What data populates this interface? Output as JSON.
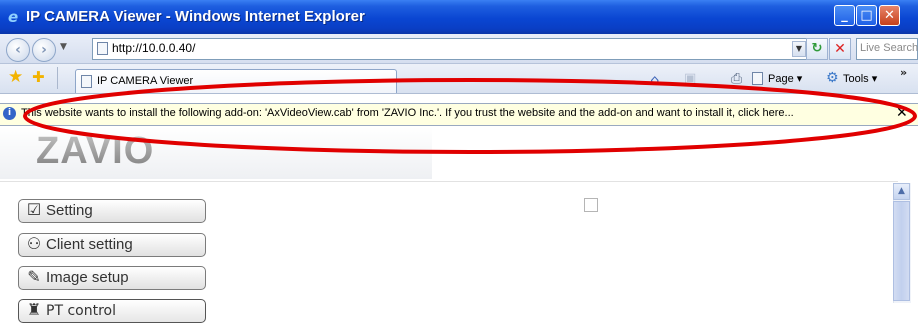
{
  "window": {
    "title": "IP CAMERA Viewer - Windows Internet Explorer",
    "controls": {
      "minimize": "_",
      "maximize": "□",
      "close": "✕"
    }
  },
  "address_bar": {
    "url": "http://10.0.0.40/",
    "search_placeholder": "Live Search"
  },
  "tabs": [
    {
      "label": "IP CAMERA Viewer"
    }
  ],
  "command_bar": {
    "page_label": "Page ▾",
    "tools_label": "Tools ▾"
  },
  "info_bar": {
    "message": "This website wants to install the following add-on: 'AxVideoView.cab' from 'ZAVIO Inc.'. If you trust the website and the add-on and want to install it, click here...",
    "close": "✕"
  },
  "page": {
    "logo_text": "ZAVIO",
    "menu": [
      {
        "label": "Setting",
        "icon": "checkmark-icon"
      },
      {
        "label": "Client setting",
        "icon": "person-icon"
      },
      {
        "label": "Image setup",
        "icon": "image-setup-icon"
      },
      {
        "label": "PT control",
        "icon": "joystick-icon"
      }
    ]
  },
  "annotation": {
    "color": "#e00000"
  }
}
